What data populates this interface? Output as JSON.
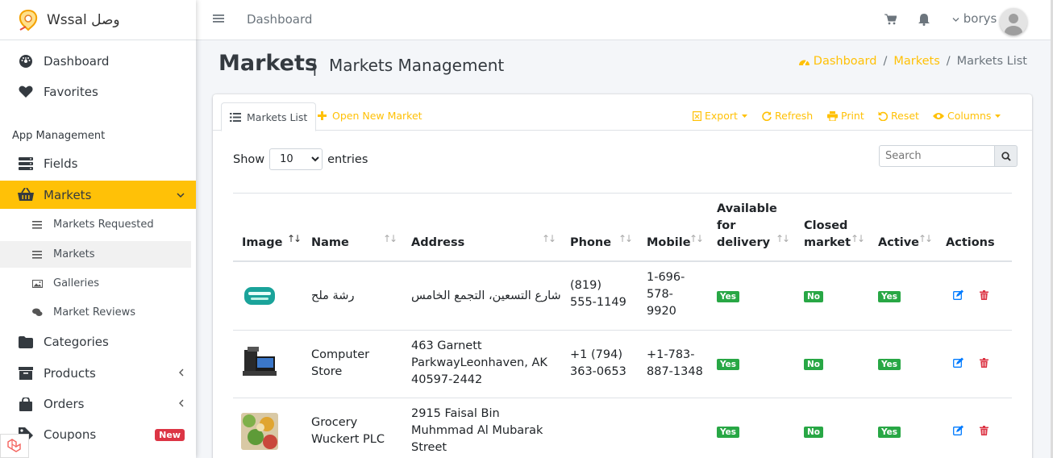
{
  "brand": {
    "name": "Wssal وصل"
  },
  "sidebar": {
    "items": [
      {
        "label": "Dashboard",
        "icon": "palette-icon"
      },
      {
        "label": "Favorites",
        "icon": "heart-icon"
      }
    ],
    "section_header": "App Management",
    "fields_label": "Fields",
    "markets_label": "Markets",
    "sub_items": [
      {
        "label": "Markets Requested",
        "icon": "list-icon"
      },
      {
        "label": "Markets",
        "icon": "list-icon"
      },
      {
        "label": "Galleries",
        "icon": "image-icon"
      },
      {
        "label": "Market Reviews",
        "icon": "comments-icon"
      }
    ],
    "categories_label": "Categories",
    "products_label": "Products",
    "orders_label": "Orders",
    "coupons_label": "Coupons",
    "coupons_badge": "New"
  },
  "topbar": {
    "title": "Dashboard",
    "user": "borys"
  },
  "page": {
    "title": "Markets",
    "separator": "|",
    "subtitle": "Markets Management"
  },
  "breadcrumb": {
    "home": "Dashboard",
    "section": "Markets",
    "current": "Markets List",
    "sep": "/"
  },
  "card": {
    "tab_active": "Markets List",
    "tab_new": "Open New Market",
    "tools": {
      "export": "Export",
      "refresh": "Refresh",
      "print": "Print",
      "reset": "Reset",
      "columns": "Columns"
    },
    "show_label": "Show",
    "entries_label": "entries",
    "entries_value": "10",
    "search_placeholder": "Search"
  },
  "table": {
    "headers": {
      "image": "Image",
      "name": "Name",
      "address": "Address",
      "phone": "Phone",
      "mobile": "Mobile",
      "delivery_1": "Available",
      "delivery_2": "for",
      "delivery_3": "delivery",
      "closed_1": "Closed",
      "closed_2": "market",
      "active": "Active",
      "actions": "Actions"
    },
    "rows": [
      {
        "name": "رشة ملح",
        "address": "شارع التسعين، التجمع الخامس",
        "phone_1": "(819)",
        "phone_2": "555-1149",
        "mobile_1": "1-696-",
        "mobile_2": "578-",
        "mobile_3": "9920",
        "delivery": "Yes",
        "closed": "No",
        "active": "Yes"
      },
      {
        "name_1": "Computer",
        "name_2": "Store",
        "address_1": "463 Garnett",
        "address_2": "ParkwayLeonhaven, AK",
        "address_3": "40597-2442",
        "phone_1": "+1 (794)",
        "phone_2": "363-0653",
        "mobile_1": "+1-783-",
        "mobile_2": "887-1348",
        "delivery": "Yes",
        "closed": "No",
        "active": "Yes"
      },
      {
        "name_1": "Grocery",
        "name_2": "Wuckert PLC",
        "address_1": "2915 Faisal Bin",
        "address_2": "Muhmmad Al Mubarak",
        "address_3": "Street",
        "delivery": "Yes",
        "closed": "No",
        "active": "Yes"
      }
    ]
  },
  "colors": {
    "accent": "#ffc107",
    "success": "#28a745",
    "danger": "#dc3545",
    "link_blue": "#007bff"
  }
}
